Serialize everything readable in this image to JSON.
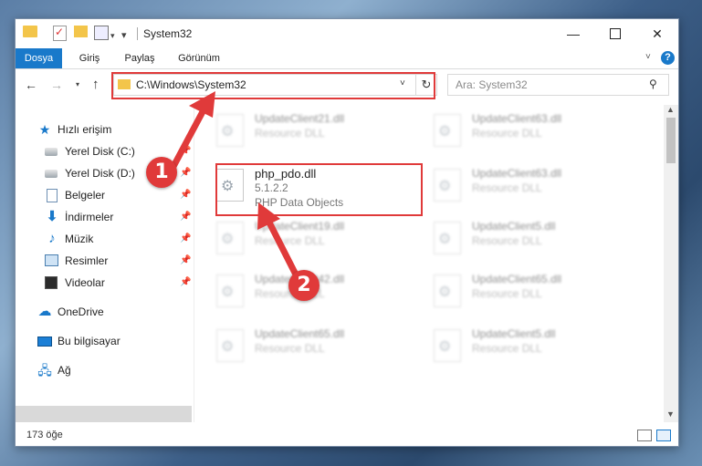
{
  "window": {
    "title": "System32",
    "controls": {
      "minimize": "—",
      "close": "✕"
    }
  },
  "ribbon": {
    "tabs": [
      "Dosya",
      "Giriş",
      "Paylaş",
      "Görünüm"
    ],
    "help": "?"
  },
  "navbar": {
    "address": "C:\\Windows\\System32",
    "search_placeholder": "Ara: System32"
  },
  "sidebar": {
    "items": [
      {
        "label": "Hızlı erişim",
        "icon": "star-icon"
      },
      {
        "label": "Yerel Disk (C:)",
        "icon": "disk-icon",
        "pinned": true
      },
      {
        "label": "Yerel Disk (D:)",
        "icon": "disk-icon",
        "pinned": true
      },
      {
        "label": "Belgeler",
        "icon": "documents-icon",
        "pinned": true
      },
      {
        "label": "İndirmeler",
        "icon": "downloads-icon",
        "pinned": true
      },
      {
        "label": "Müzik",
        "icon": "music-icon",
        "pinned": true
      },
      {
        "label": "Resimler",
        "icon": "pictures-icon",
        "pinned": true
      },
      {
        "label": "Videolar",
        "icon": "videos-icon",
        "pinned": true
      },
      {
        "label": "OneDrive",
        "icon": "onedrive-icon"
      },
      {
        "label": "Bu bilgisayar",
        "icon": "this-pc-icon",
        "selected": true
      },
      {
        "label": "Ağ",
        "icon": "network-icon"
      }
    ]
  },
  "files": [
    {
      "name": "UpdateClient21.dll",
      "type": "Resource DLL"
    },
    {
      "name": "UpdateClient63.dll",
      "type": "Resource DLL"
    },
    {
      "name": "UpdateClient63.dll",
      "type": "Resource DLL"
    },
    {
      "name": "UpdateClient19.dll",
      "type": "Resource DLL"
    },
    {
      "name": "UpdateClient5.dll",
      "type": "Resource DLL"
    },
    {
      "name": "UpdateClient42.dll",
      "type": "Resource DLL"
    },
    {
      "name": "UpdateClient65.dll",
      "type": "Resource DLL"
    },
    {
      "name": "UpdateClient65.dll",
      "type": "Resource DLL"
    },
    {
      "name": "UpdateClient5.dll",
      "type": "Resource DLL"
    }
  ],
  "selected_file": {
    "name": "php_pdo.dll",
    "version": "5.1.2.2",
    "description": "PHP Data Objects"
  },
  "status": {
    "count": "173 öğe"
  },
  "annotations": {
    "step1": "1",
    "step2": "2"
  },
  "colors": {
    "accent": "#1979ca",
    "highlight": "#e03a3a"
  }
}
